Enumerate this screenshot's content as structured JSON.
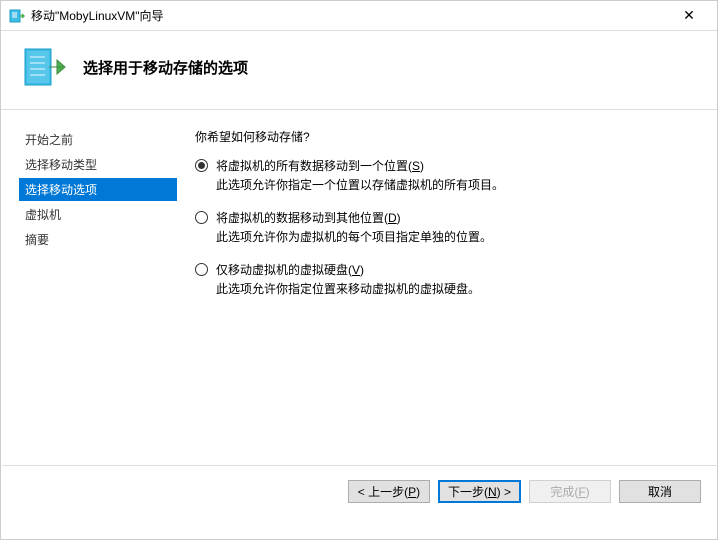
{
  "titlebar": {
    "title": "移动\"MobyLinuxVM\"向导",
    "close_glyph": "✕"
  },
  "header": {
    "title": "选择用于移动存储的选项"
  },
  "sidebar": {
    "items": [
      {
        "label": "开始之前"
      },
      {
        "label": "选择移动类型"
      },
      {
        "label": "选择移动选项"
      },
      {
        "label": "虚拟机"
      },
      {
        "label": "摘要"
      }
    ]
  },
  "main": {
    "question": "你希望如何移动存储?",
    "options": [
      {
        "label_pre": "将虚拟机的所有数据移动到一个位置(",
        "accel": "S",
        "label_post": ")",
        "desc": "此选项允许你指定一个位置以存储虚拟机的所有项目。",
        "checked": true
      },
      {
        "label_pre": "将虚拟机的数据移动到其他位置(",
        "accel": "D",
        "label_post": ")",
        "desc": "此选项允许你为虚拟机的每个项目指定单独的位置。",
        "checked": false
      },
      {
        "label_pre": "仅移动虚拟机的虚拟硬盘(",
        "accel": "V",
        "label_post": ")",
        "desc": "此选项允许你指定位置来移动虚拟机的虚拟硬盘。",
        "checked": false
      }
    ]
  },
  "footer": {
    "prev_pre": "< 上一步(",
    "prev_accel": "P",
    "prev_post": ")",
    "next_pre": "下一步(",
    "next_accel": "N",
    "next_post": ") >",
    "finish_pre": "完成(",
    "finish_accel": "F",
    "finish_post": ")",
    "cancel": "取消"
  }
}
